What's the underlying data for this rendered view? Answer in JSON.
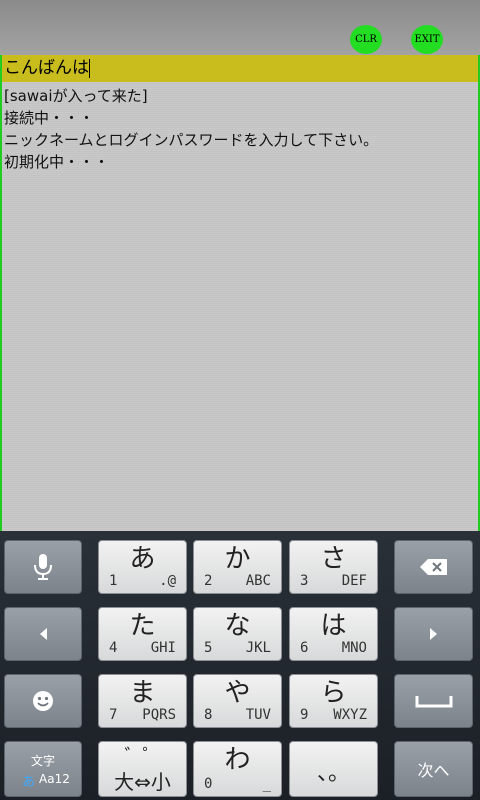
{
  "toolbar": {
    "clear_label": "CLR",
    "exit_label": "EXIT"
  },
  "input": {
    "value": "こんばんは"
  },
  "log": {
    "lines": [
      "[sawaiが入って来た]",
      "接続中・・・",
      "ニックネームとログインパスワードを入力して下さい。",
      "初期化中・・・"
    ]
  },
  "keyboard": {
    "keys": [
      {
        "kana": "あ",
        "num": "1",
        "alpha": ".@"
      },
      {
        "kana": "か",
        "num": "2",
        "alpha": "ABC"
      },
      {
        "kana": "さ",
        "num": "3",
        "alpha": "DEF"
      },
      {
        "kana": "た",
        "num": "4",
        "alpha": "GHI"
      },
      {
        "kana": "な",
        "num": "5",
        "alpha": "JKL"
      },
      {
        "kana": "は",
        "num": "6",
        "alpha": "MNO"
      },
      {
        "kana": "ま",
        "num": "7",
        "alpha": "PQRS"
      },
      {
        "kana": "や",
        "num": "8",
        "alpha": "TUV"
      },
      {
        "kana": "ら",
        "num": "9",
        "alpha": "WXYZ"
      }
    ],
    "mode_label_top": "文字",
    "mode_label_hira": "あ",
    "mode_label_rest": "Aa12",
    "dakuten_top": "゛゜",
    "dakuten_bottom": "大⇔小",
    "wa_kana": "わ",
    "wa_num": "0",
    "wa_alpha": "_",
    "punct_label": "、。",
    "next_label": "次へ",
    "accent_color": "#22dd22"
  }
}
